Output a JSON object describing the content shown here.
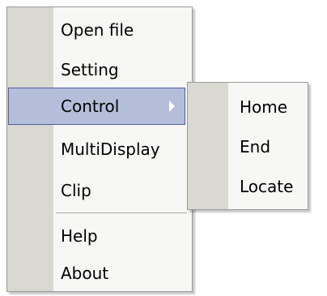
{
  "main_menu": {
    "items": [
      {
        "label": "Open file"
      },
      {
        "label": "Setting"
      },
      {
        "label": "Control",
        "has_submenu": true,
        "highlighted": true
      },
      {
        "label": "MultiDisplay"
      },
      {
        "label": "Clip"
      },
      {
        "label": "Help"
      },
      {
        "label": "About"
      }
    ]
  },
  "submenu": {
    "parent": "Control",
    "items": [
      {
        "label": "Home"
      },
      {
        "label": "End"
      },
      {
        "label": "Locate"
      }
    ]
  },
  "colors": {
    "menu_background": "#f7f7f5",
    "gutter": "#d9d8d1",
    "highlight_fill": "#b4bed9",
    "highlight_border": "#4b5fa3",
    "border": "#9a9a9a"
  }
}
